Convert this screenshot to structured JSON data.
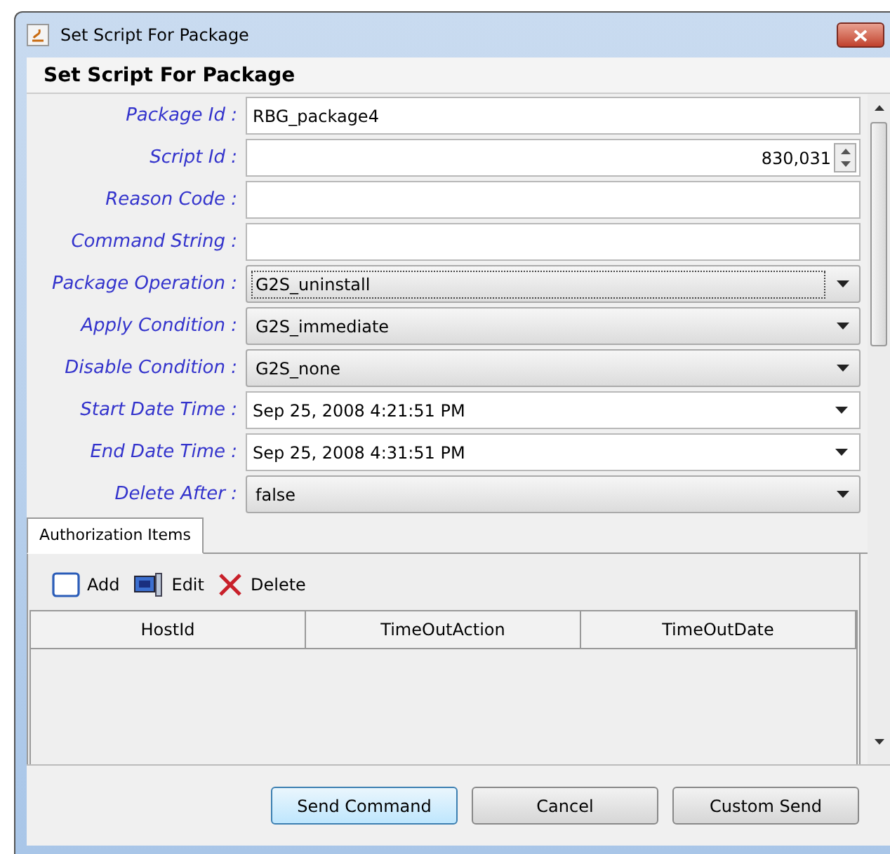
{
  "window": {
    "title": "Set Script For Package"
  },
  "header": "Set Script For Package",
  "fields": [
    {
      "label": "Package Id :",
      "kind": "text",
      "value": "RBG_package4"
    },
    {
      "label": "Script Id :",
      "kind": "spinner",
      "value": "830,031"
    },
    {
      "label": "Reason Code :",
      "kind": "text"
    },
    {
      "label": "Command String :",
      "kind": "text"
    },
    {
      "label": "Package Operation :",
      "kind": "combo",
      "value": "G2S_uninstall",
      "focused": true
    },
    {
      "label": "Apply Condition :",
      "kind": "combo",
      "value": "G2S_immediate",
      "focused": false
    },
    {
      "label": "Disable Condition :",
      "kind": "combo",
      "value": "G2S_none",
      "focused": false
    },
    {
      "label": "Start Date Time :",
      "kind": "date",
      "value": "Sep 25, 2008 4:21:51 PM"
    },
    {
      "label": "End Date Time :",
      "kind": "date",
      "value": "Sep 25, 2008 4:31:51 PM"
    },
    {
      "label": "Delete After :",
      "kind": "combo",
      "value": "false",
      "focused": false
    }
  ],
  "tabs": [
    {
      "label": "Authorization Items",
      "selected": true
    }
  ],
  "toolbar": [
    {
      "label": "Add",
      "kind": "add"
    },
    {
      "label": "Edit",
      "kind": "edit"
    },
    {
      "label": "Delete",
      "kind": "delete"
    }
  ],
  "table": {
    "columns": [
      "HostId",
      "TimeOutAction",
      "TimeOutDate"
    ]
  },
  "buttons": [
    {
      "label": "Send Command",
      "default": true
    },
    {
      "label": "Cancel",
      "default": false
    },
    {
      "label": "Custom Send",
      "default": false
    }
  ]
}
